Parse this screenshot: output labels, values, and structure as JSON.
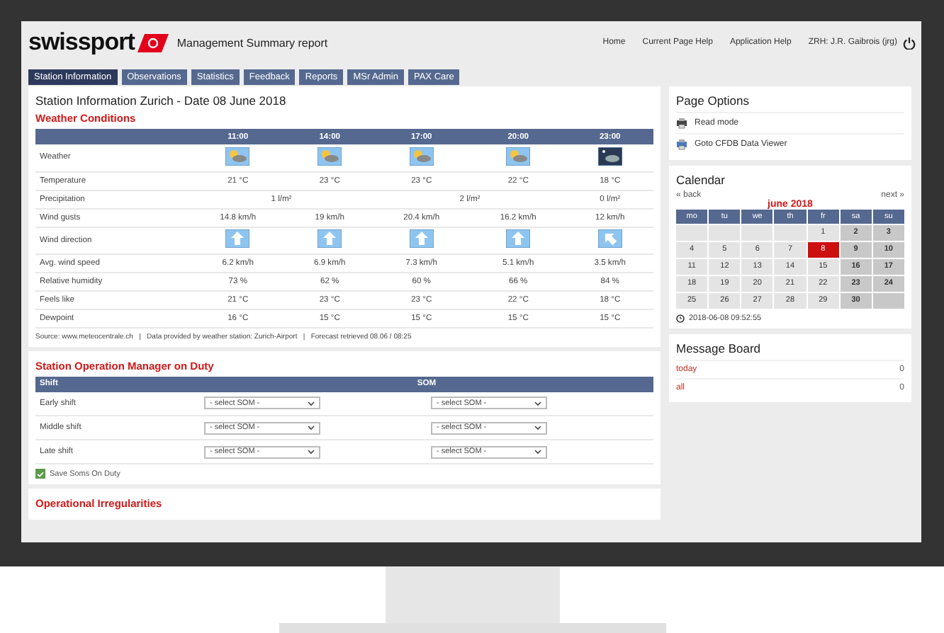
{
  "header": {
    "logo": "swissport",
    "title": "Management Summary report",
    "links": [
      "Home",
      "Current Page Help",
      "Application Help",
      "ZRH: J.R. Gaibrois (jrg)"
    ]
  },
  "tabs": [
    {
      "label": "Station Information",
      "selected": true
    },
    {
      "label": "Observations",
      "selected": false
    },
    {
      "label": "Statistics",
      "selected": false
    },
    {
      "label": "Feedback",
      "selected": false
    },
    {
      "label": "Reports",
      "selected": false
    },
    {
      "label": "MSr Admin",
      "selected": false
    },
    {
      "label": "PAX Care",
      "selected": false
    }
  ],
  "station": {
    "title": "Station Information Zurich - Date 08 June 2018",
    "heading": "Weather Conditions",
    "times": [
      "11:00",
      "14:00",
      "17:00",
      "20:00",
      "23:00"
    ],
    "rows": [
      {
        "label": "Weather",
        "kind": "weather",
        "cells": [
          {
            "kind": "sun-cloud"
          },
          {
            "kind": "sun-cloud"
          },
          {
            "kind": "sun-cloud"
          },
          {
            "kind": "sun-cloud"
          },
          {
            "kind": "moon-cloud"
          }
        ]
      },
      {
        "label": "Temperature",
        "kind": "text",
        "cells": [
          {
            "text": "21 °C"
          },
          {
            "text": "23 °C"
          },
          {
            "text": "23 °C"
          },
          {
            "text": "22 °C"
          },
          {
            "text": "18 °C"
          }
        ]
      },
      {
        "label": "Precipitation",
        "kind": "text",
        "cells": [
          {
            "text": "1 l/m²",
            "colspan": 2
          },
          {
            "text": "2 l/m²",
            "colspan": 2
          },
          {
            "text": "0 l/m²"
          }
        ]
      },
      {
        "label": "Wind gusts",
        "kind": "text",
        "cells": [
          {
            "text": "14.8 km/h"
          },
          {
            "text": "19 km/h"
          },
          {
            "text": "20.4 km/h"
          },
          {
            "text": "16.2 km/h"
          },
          {
            "text": "12 km/h"
          }
        ]
      },
      {
        "label": "Wind direction",
        "kind": "wind",
        "cells": [
          {
            "kind": "arrow-up"
          },
          {
            "kind": "arrow-up"
          },
          {
            "kind": "arrow-up"
          },
          {
            "kind": "arrow-up"
          },
          {
            "kind": "arrow-up-left"
          }
        ]
      },
      {
        "label": "Avg. wind speed",
        "kind": "text",
        "cells": [
          {
            "text": "6.2 km/h"
          },
          {
            "text": "6.9 km/h"
          },
          {
            "text": "7.3 km/h"
          },
          {
            "text": "5.1 km/h"
          },
          {
            "text": "3.5 km/h"
          }
        ]
      },
      {
        "label": "Relative humidity",
        "kind": "text",
        "cells": [
          {
            "text": "73 %"
          },
          {
            "text": "62 %"
          },
          {
            "text": "60 %"
          },
          {
            "text": "66 %"
          },
          {
            "text": "84 %"
          }
        ]
      },
      {
        "label": "Feels like",
        "kind": "text",
        "cells": [
          {
            "text": "21 °C"
          },
          {
            "text": "23 °C"
          },
          {
            "text": "23 °C"
          },
          {
            "text": "22 °C"
          },
          {
            "text": "18 °C"
          }
        ]
      },
      {
        "label": "Dewpoint",
        "kind": "text",
        "cells": [
          {
            "text": "16 °C"
          },
          {
            "text": "15 °C"
          },
          {
            "text": "15 °C"
          },
          {
            "text": "15 °C"
          },
          {
            "text": "15 °C"
          }
        ]
      }
    ],
    "source": "Source: www.meteocentrale.ch   |   Data provided by weather station: Zurich-Airport   |   Forecast retrieved 08.06 / 08:25"
  },
  "som": {
    "heading": "Station Operation Manager on Duty",
    "columns": [
      "Shift",
      "SOM"
    ],
    "rows": [
      {
        "label": "Early shift",
        "selects": [
          "- select SOM -",
          "- select SOM -"
        ]
      },
      {
        "label": "Middle shift",
        "selects": [
          "- select SOM -",
          "- select SOM -"
        ]
      },
      {
        "label": "Late shift",
        "selects": [
          "- select SOM -",
          "- select SOM -"
        ]
      }
    ],
    "save": {
      "label": "Save Soms On Duty",
      "checked": true
    }
  },
  "next_section": {
    "heading": "Operational Irregularities"
  },
  "page_options": {
    "title": "Page Options",
    "items": [
      {
        "label": "Read mode",
        "kind": "read"
      },
      {
        "label": "Goto CFDB Data Viewer",
        "kind": "viewer"
      }
    ]
  },
  "calendar": {
    "title": "Calendar",
    "back": "« back",
    "next": "next »",
    "month": "june 2018",
    "weekdays": [
      "mo",
      "tu",
      "we",
      "th",
      "fr",
      "sa",
      "su"
    ],
    "weeks": [
      [
        {
          "kind": "blank"
        },
        {
          "kind": "blank"
        },
        {
          "kind": "blank"
        },
        {
          "kind": "blank"
        },
        {
          "kind": "day",
          "label": "1",
          "selected": false
        },
        {
          "kind": "day",
          "label": "2",
          "selected": false
        },
        {
          "kind": "day",
          "label": "3",
          "selected": false
        }
      ],
      [
        {
          "kind": "day",
          "label": "4",
          "selected": false
        },
        {
          "kind": "day",
          "label": "5",
          "selected": false
        },
        {
          "kind": "day",
          "label": "6",
          "selected": false
        },
        {
          "kind": "day",
          "label": "7",
          "selected": false
        },
        {
          "kind": "day",
          "label": "8",
          "selected": true
        },
        {
          "kind": "day",
          "label": "9",
          "selected": false
        },
        {
          "kind": "day",
          "label": "10",
          "selected": false
        }
      ],
      [
        {
          "kind": "day",
          "label": "11",
          "selected": false
        },
        {
          "kind": "day",
          "label": "12",
          "selected": false
        },
        {
          "kind": "day",
          "label": "13",
          "selected": false
        },
        {
          "kind": "day",
          "label": "14",
          "selected": false
        },
        {
          "kind": "day",
          "label": "15",
          "selected": false
        },
        {
          "kind": "day",
          "label": "16",
          "selected": false
        },
        {
          "kind": "day",
          "label": "17",
          "selected": false
        }
      ],
      [
        {
          "kind": "day",
          "label": "18",
          "selected": false
        },
        {
          "kind": "day",
          "label": "19",
          "selected": false
        },
        {
          "kind": "day",
          "label": "20",
          "selected": false
        },
        {
          "kind": "day",
          "label": "21",
          "selected": false
        },
        {
          "kind": "day",
          "label": "22",
          "selected": false
        },
        {
          "kind": "day",
          "label": "23",
          "selected": false
        },
        {
          "kind": "day",
          "label": "24",
          "selected": false
        }
      ],
      [
        {
          "kind": "day",
          "label": "25",
          "selected": false
        },
        {
          "kind": "day",
          "label": "26",
          "selected": false
        },
        {
          "kind": "day",
          "label": "27",
          "selected": false
        },
        {
          "kind": "day",
          "label": "28",
          "selected": false
        },
        {
          "kind": "day",
          "label": "29",
          "selected": false
        },
        {
          "kind": "day",
          "label": "30",
          "selected": false
        },
        {
          "kind": "blank"
        }
      ]
    ],
    "timestamp": "2018-06-08 09:52:55"
  },
  "message_board": {
    "title": "Message Board",
    "items": [
      {
        "label": "today",
        "count": "0"
      },
      {
        "label": "all",
        "count": "0"
      }
    ]
  }
}
